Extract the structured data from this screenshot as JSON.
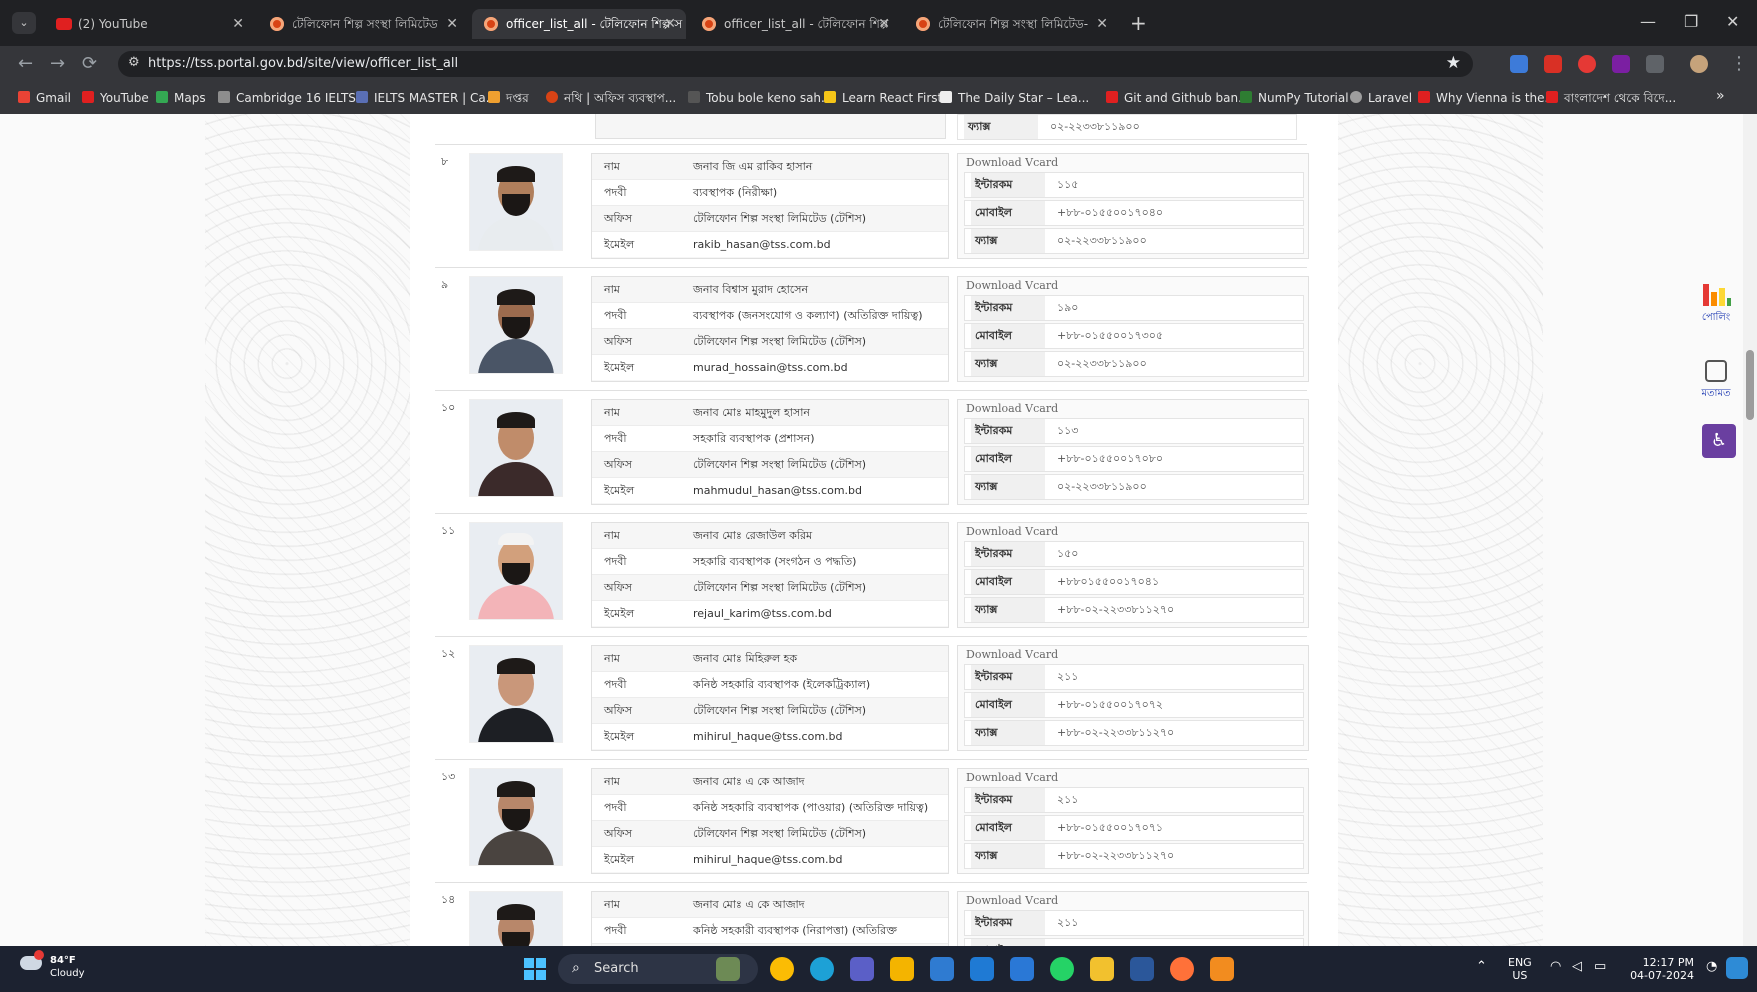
{
  "browser": {
    "tabs": [
      {
        "title": "(2) YouTube",
        "favicon": "youtube-icon",
        "active": false
      },
      {
        "title": "টেলিফোন শিল্প সংস্থা লিমিটেড",
        "favicon": "gov-portal-icon",
        "active": false
      },
      {
        "title": "officer_list_all - টেলিফোন শিল্প স",
        "favicon": "gov-portal-icon",
        "active": true
      },
      {
        "title": "officer_list_all - টেলিফোন শিল্প",
        "favicon": "gov-portal-icon",
        "active": false
      },
      {
        "title": "টেলিফোন শিল্প সংস্থা লিমিটেড-",
        "favicon": "gov-portal-icon",
        "active": false
      }
    ],
    "url": "https://tss.portal.gov.bd/site/view/officer_list_all",
    "bookmarks": [
      "Gmail",
      "YouTube",
      "Maps",
      "Cambridge 16 IELTS...",
      "IELTS MASTER | Ca...",
      "দপ্তর",
      "নথি | অফিস ব্যবস্থাপ...",
      "Tobu bole keno sah...",
      "Learn React First",
      "The Daily Star – Lea...",
      "Git and Github ban...",
      "NumPy Tutorial",
      "Laravel",
      "Why Vienna is the...",
      "বাংলাদেশ থেকে বিদে..."
    ]
  },
  "labels": {
    "name": "নাম",
    "designation": "পদবী",
    "office": "অফিস",
    "email": "ইমেইল",
    "download": "Download Vcard",
    "extension": "ইন্টারকম",
    "mobile": "মোবাইল",
    "fax": "ফ্যাক্স"
  },
  "top_partial_fax": "০২-২২৩৩৮১১৯০০",
  "officers": [
    {
      "serial": "৮",
      "name": "জনাব জি এম রাকিব হাসান",
      "designation": "ব্যবস্থাপক (নিরীক্ষা)",
      "office": "টেলিফোন শিল্প সংস্থা লিমিটেড (টেশিস)",
      "email": "rakib_hasan@tss.com.bd",
      "extension": "১১৫",
      "mobile": "+৮৮-০১৫৫০০১৭০৪০",
      "fax": "০২-২২৩৩৮১১৯০০",
      "photo": {
        "skin": "#b07f5c",
        "suit": "#e8ecef",
        "beard": true,
        "cap": false
      }
    },
    {
      "serial": "৯",
      "name": "জনাব বিশ্বাস মুরাদ হোসেন",
      "designation": "ব্যবস্থাপক (জনসংযোগ ও কল্যাণ) (অতিরিক্ত দায়িত্ব)",
      "office": "টেলিফোন শিল্প সংস্থা লিমিটেড (টেশিস)",
      "email": "murad_hossain@tss.com.bd",
      "extension": "১৯০",
      "mobile": "+৮৮-০১৫৫০০১৭৩০৫",
      "fax": "০২-২২৩৩৮১১৯০০",
      "photo": {
        "skin": "#9c6b4e",
        "suit": "#4a5566",
        "beard": true,
        "cap": false
      }
    },
    {
      "serial": "১০",
      "name": "জনাব মোঃ মাহমুদুল হাসান",
      "designation": "সহকারি ব্যবস্থাপক (প্রশাসন)",
      "office": "টেলিফোন শিল্প সংস্থা লিমিটেড (টেশিস)",
      "email": "mahmudul_hasan@tss.com.bd",
      "extension": "১১৩",
      "mobile": "+৮৮-০১৫৫০০১৭০৮০",
      "fax": "০২-২২৩৩৮১১৯০০",
      "photo": {
        "skin": "#c08c6a",
        "suit": "#3b2a2a",
        "beard": false,
        "cap": false
      }
    },
    {
      "serial": "১১",
      "name": "জনাব মোঃ রেজাউল করিম",
      "designation": "সহকারি ব্যবস্থাপক (সংগঠন ও পদ্ধতি)",
      "office": "টেলিফোন শিল্প সংস্থা লিমিটেড (টেশিস)",
      "email": "rejaul_karim@tss.com.bd",
      "extension": "১৫০",
      "mobile": "+৮৮০১৫৫০০১৭০৪১",
      "fax": "+৮৮-০২-২২৩৩৮১১২৭০",
      "photo": {
        "skin": "#d2a07c",
        "suit": "#f3b4b8",
        "beard": true,
        "cap": true
      }
    },
    {
      "serial": "১২",
      "name": "জনাব মোঃ মিহিরুল হক",
      "designation": "কনিষ্ঠ সহকারি ব্যবস্থাপক (ইলেকট্রিক্যাল)",
      "office": "টেলিফোন শিল্প সংস্থা লিমিটেড (টেশিস)",
      "email": "mihirul_haque@tss.com.bd",
      "extension": "২১১",
      "mobile": "+৮৮-০১৫৫০০১৭০৭২",
      "fax": "+৮৮-০২-২২৩৩৮১১২৭০",
      "photo": {
        "skin": "#c9977a",
        "suit": "#1d1f24",
        "beard": false,
        "cap": false
      }
    },
    {
      "serial": "১৩",
      "name": "জনাব মোঃ এ কে আজাদ",
      "designation": "কনিষ্ঠ সহকারি ব্যবস্থাপক (পাওয়ার) (অতিরিক্ত দায়িত্ব)",
      "office": "টেলিফোন শিল্প সংস্থা লিমিটেড (টেশিস)",
      "email": "mihirul_haque@tss.com.bd",
      "extension": "২১১",
      "mobile": "+৮৮-০১৫৫০০১৭০৭১",
      "fax": "+৮৮-০২-২২৩৩৮১১২৭০",
      "photo": {
        "skin": "#b8876a",
        "suit": "#4a4440",
        "beard": true,
        "cap": false
      }
    },
    {
      "serial": "১৪",
      "name": "জনাব মোঃ এ কে আজাদ",
      "designation": "কনিষ্ঠ সহকারী ব্যবস্থাপক (নিরাপত্তা) (অতিরিক্ত",
      "office": "",
      "email": "",
      "extension": "২১১",
      "mobile": "",
      "fax": "",
      "photo": {
        "skin": "#b8876a",
        "suit": "#4a4440",
        "beard": true,
        "cap": false
      }
    }
  ],
  "side_widgets": {
    "stats_label": "পোলিং",
    "feedback_label": "মতামত"
  },
  "taskbar": {
    "temperature": "84°F",
    "weather": "Cloudy",
    "search_placeholder": "Search",
    "language": "ENG",
    "region": "US",
    "time": "12:17 PM",
    "date": "04-07-2024"
  },
  "colors": {
    "accent": "#1f3bb3",
    "chrome_dark": "#202124",
    "taskbar": "#1c2230"
  }
}
